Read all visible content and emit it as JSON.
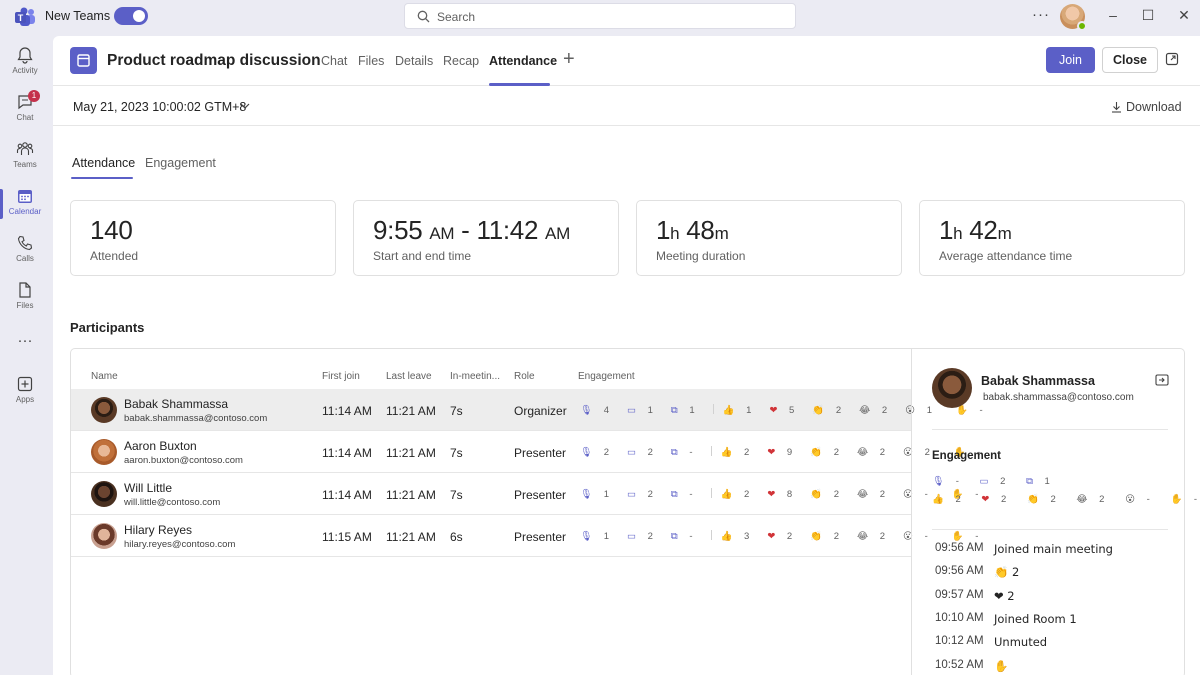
{
  "titlebar": {
    "app_label": "New Teams",
    "toggle_on": true,
    "search_placeholder": "Search",
    "more_label": "···"
  },
  "rail": {
    "items": [
      {
        "label": "Activity",
        "icon": "bell-icon",
        "badge": ""
      },
      {
        "label": "Chat",
        "icon": "chat-icon",
        "badge": "1"
      },
      {
        "label": "Teams",
        "icon": "teams-icon",
        "badge": ""
      },
      {
        "label": "Calendar",
        "icon": "calendar-icon",
        "badge": "",
        "active": true
      },
      {
        "label": "Calls",
        "icon": "phone-icon",
        "badge": ""
      },
      {
        "label": "Files",
        "icon": "file-icon",
        "badge": ""
      },
      {
        "label": "···",
        "icon": "more-icon",
        "badge": ""
      },
      {
        "label": "Apps",
        "icon": "add-app-icon",
        "badge": ""
      }
    ]
  },
  "header": {
    "title": "Product roadmap discussion",
    "tabs": [
      "Chat",
      "Files",
      "Details",
      "Recap",
      "Attendance"
    ],
    "active_tab": "Attendance",
    "join_label": "Join",
    "close_label": "Close"
  },
  "datebar": {
    "date": "May 21, 2023 10:00:02 GTM+8",
    "download_label": "Download"
  },
  "subtabs": [
    "Attendance",
    "Engagement"
  ],
  "stats": [
    {
      "value": "140",
      "caption": "Attended"
    },
    {
      "v1": "9:55",
      "u1": "AM",
      "sep": " - ",
      "v2": "11:42",
      "u2": "AM",
      "caption": "Start and end time"
    },
    {
      "v1": "1",
      "u1": "h",
      "v2": "48",
      "u2": "m",
      "caption": "Meeting duration"
    },
    {
      "v1": "1",
      "u1": "h",
      "v2": "42",
      "u2": "m",
      "caption": "Average attendance time"
    }
  ],
  "participants": {
    "heading": "Participants",
    "columns": [
      "Name",
      "First join",
      "Last leave",
      "In-meetin...",
      "Role",
      "Engagement"
    ],
    "rows": [
      {
        "name": "Babak Shammassa",
        "email": "babak.shammassa@contoso.com",
        "first_join": "11:14 AM",
        "last_leave": "11:21 AM",
        "in_meeting": "7s",
        "role": "Organizer",
        "mic": "4",
        "cam": "1",
        "share": "1",
        "like": "1",
        "heart": "5",
        "clap": "2",
        "laugh": "2",
        "wow": "1",
        "hand": "-"
      },
      {
        "name": "Aaron Buxton",
        "email": "aaron.buxton@contoso.com",
        "first_join": "11:14 AM",
        "last_leave": "11:21 AM",
        "in_meeting": "7s",
        "role": "Presenter",
        "mic": "2",
        "cam": "2",
        "share": "-",
        "like": "2",
        "heart": "9",
        "clap": "2",
        "laugh": "2",
        "wow": "2",
        "hand": "-"
      },
      {
        "name": "Will Little",
        "email": "will.little@contoso.com",
        "first_join": "11:14 AM",
        "last_leave": "11:21 AM",
        "in_meeting": "7s",
        "role": "Presenter",
        "mic": "1",
        "cam": "2",
        "share": "-",
        "like": "2",
        "heart": "8",
        "clap": "2",
        "laugh": "2",
        "wow": "-",
        "hand": "-"
      },
      {
        "name": "Hilary Reyes",
        "email": "hilary.reyes@contoso.com",
        "first_join": "11:15 AM",
        "last_leave": "11:21 AM",
        "in_meeting": "6s",
        "role": "Presenter",
        "mic": "1",
        "cam": "2",
        "share": "-",
        "like": "3",
        "heart": "2",
        "clap": "2",
        "laugh": "2",
        "wow": "-",
        "hand": "-"
      }
    ]
  },
  "detail": {
    "name": "Babak Shammassa",
    "email": "babak.shammassa@contoso.com",
    "engagement_heading": "Engagement",
    "mic": "-",
    "cam": "2",
    "share": "1",
    "like": "2",
    "heart": "2",
    "clap": "2",
    "laugh": "2",
    "wow": "-",
    "hand": "-",
    "timeline": [
      {
        "time": "09:56 AM",
        "event": "Joined main meeting"
      },
      {
        "time": "09:56 AM",
        "event": "👏 2"
      },
      {
        "time": "09:57 AM",
        "event": "❤ 2"
      },
      {
        "time": "10:10 AM",
        "event": "Joined Room 1"
      },
      {
        "time": "10:12 AM",
        "event": "Unmuted"
      },
      {
        "time": "10:52 AM",
        "event": "✋"
      }
    ]
  },
  "colors": {
    "accent": "#5b5fc7",
    "badge": "#c4314b",
    "presence": "#6bb700"
  }
}
